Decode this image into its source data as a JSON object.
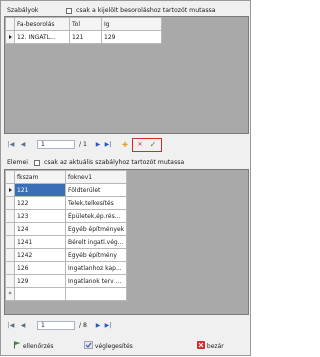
{
  "top": {
    "group_label": "Szabályok",
    "filter_label": "csak a kijelölt besoroláshoz tartozót mutassa",
    "columns": [
      "Fa-besorolás",
      "Tol",
      "Ig"
    ],
    "rows": [
      {
        "fa": "12. INGATL...",
        "tol": "121",
        "ig": "129"
      }
    ],
    "nav": {
      "position": "1",
      "count": "/ 1"
    }
  },
  "bottom": {
    "group_label": "Elemei",
    "filter_label": "csak az aktuális szabályhoz tartozót mutassa",
    "columns": [
      "fkszam",
      "foknev1"
    ],
    "rows": [
      {
        "fkszam": "121",
        "foknev": "Földterület"
      },
      {
        "fkszam": "122",
        "foknev": "Telek,telkesítés"
      },
      {
        "fkszam": "123",
        "foknev": "Épületek,ép.rés..."
      },
      {
        "fkszam": "124",
        "foknev": "Egyéb építmények"
      },
      {
        "fkszam": "1241",
        "foknev": "Bérelt ingatl.vég..."
      },
      {
        "fkszam": "1242",
        "foknev": "Egyéb építmény"
      },
      {
        "fkszam": "126",
        "foknev": "Ingatlanhoz kap..."
      },
      {
        "fkszam": "129",
        "foknev": "Ingatlanok terv ..."
      }
    ],
    "new_row_marker": "*",
    "nav": {
      "position": "1",
      "count": "/ 8"
    }
  },
  "footer": {
    "check_label": "ellenőrzés",
    "finalize_label": "véglegesítés",
    "close_label": "bezár"
  },
  "icons": {
    "first": "|◀",
    "prev": "◀",
    "next": "▶",
    "last": "▶|",
    "add": "✚",
    "delete": "✕",
    "save": "✓"
  },
  "colors": {
    "accent": "#2a56c6",
    "selection": "#3a6fb8",
    "delete_red": "#d22b2b",
    "save_green": "#2e9a2e",
    "add_orange": "#e8a020"
  }
}
